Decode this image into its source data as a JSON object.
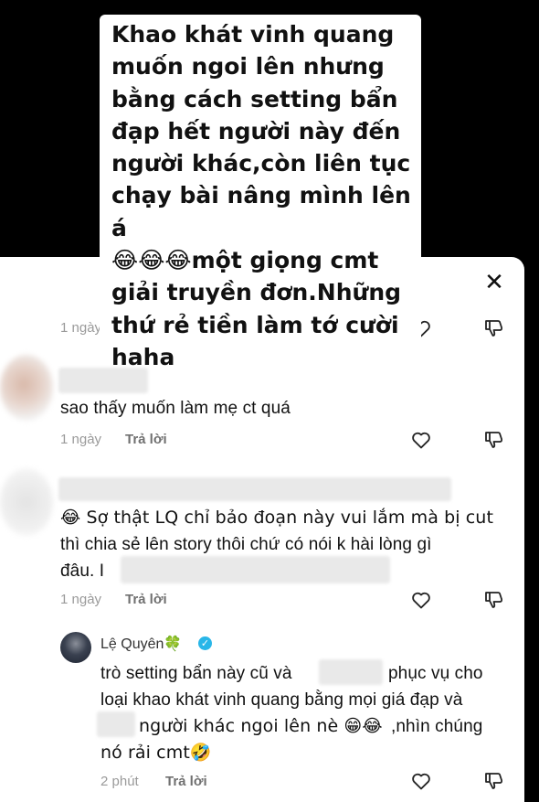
{
  "overlay": {
    "text": "Khao khát vinh quang\nmuốn ngoi lên nhưng\nbằng cách setting bẩn\nđạp hết người này đến\nngười khác,còn liên tục\nchạy bài nâng mình lên á\n😂😂😂một giọng cmt\ngiải truyền đơn.Những\nthứ rẻ tiền làm tớ cười\nhaha"
  },
  "sheet": {
    "close_icon": "close-icon"
  },
  "comments": [
    {
      "time": "1 ngày"
    },
    {
      "text": "sao thấy muốn làm mẹ ct quá",
      "time": "1 ngày",
      "reply": "Trả lời"
    },
    {
      "line1": "😂 Sợ thật LQ chỉ bảo đoạn này vui lắm mà bị cut",
      "line2": "thì chia sẻ lên story thôi chứ có nói k hài lòng gì",
      "line3": "đâu. I",
      "time": "1 ngày",
      "reply": "Trả lời"
    },
    {
      "username": "Lệ Quyên🍀",
      "verified": "✓",
      "line1a": "trò setting bẩn này cũ và",
      "line1b": "phục vụ cho",
      "line2": "loại khao khát vinh quang bằng mọi giá đạp và",
      "line3a": "người khác ngoi lên nè 😁😂",
      "line3b": ",nhìn chúng",
      "line4": "nó rải cmt🤣",
      "time": "2 phút",
      "reply": "Trả lời"
    }
  ],
  "icons": {
    "like": "heart-outline-icon",
    "dislike": "thumbs-down-outline-icon"
  }
}
